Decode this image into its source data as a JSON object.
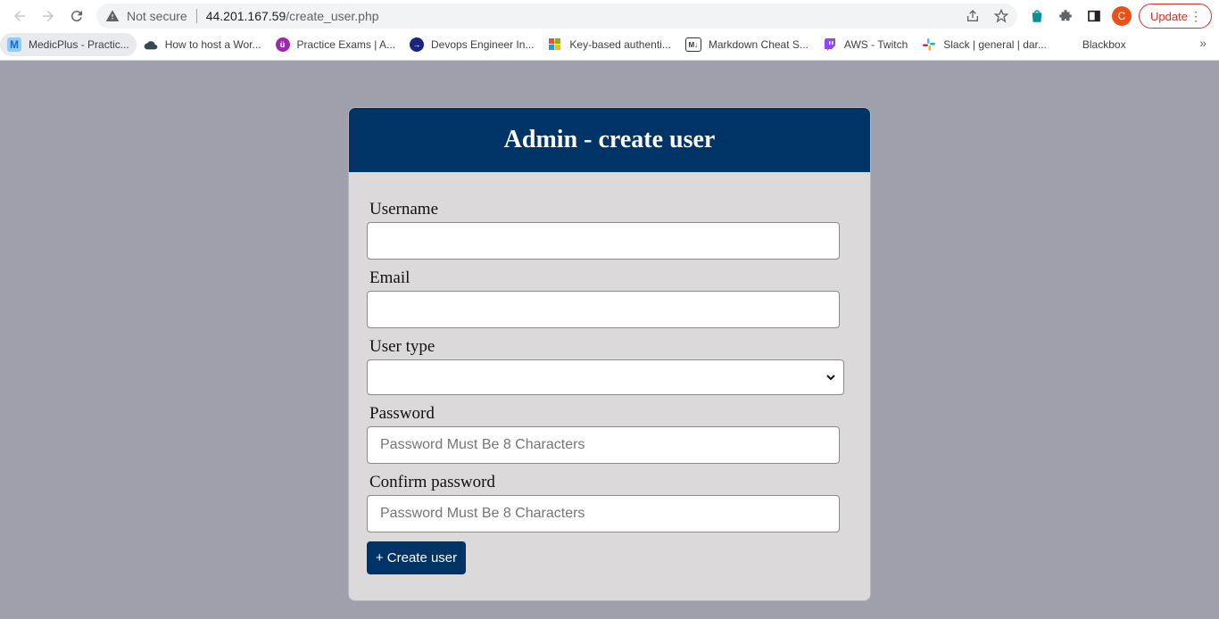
{
  "browser": {
    "security_label": "Not secure",
    "url_host": "44.201.167.59",
    "url_path": "/create_user.php",
    "avatar_letter": "C",
    "update_label": "Update"
  },
  "bookmarks": [
    {
      "label": "MedicPlus - Practic...",
      "icon": "M",
      "color": "#1565c0"
    },
    {
      "label": "How to host a Wor...",
      "icon": "cloud",
      "color": "#37474f"
    },
    {
      "label": "Practice Exams | A...",
      "icon": "ü",
      "color": "#9c27b0"
    },
    {
      "label": "Devops Engineer In...",
      "icon": "→",
      "color": "#1a237e"
    },
    {
      "label": "Key-based authenti...",
      "icon": "win",
      "color": "#f25022"
    },
    {
      "label": "Markdown Cheat S...",
      "icon": "M↓",
      "color": "#333333"
    },
    {
      "label": "AWS - Twitch",
      "icon": "tw",
      "color": "#9146ff"
    },
    {
      "label": "Slack | general | dar...",
      "icon": "#",
      "color": "#e01e5a"
    },
    {
      "label": "Blackbox",
      "icon": "",
      "color": "#ffffff"
    }
  ],
  "form": {
    "title": "Admin - create user",
    "username_label": "Username",
    "username_value": "",
    "email_label": "Email",
    "email_value": "",
    "usertype_label": "User type",
    "usertype_value": "",
    "password_label": "Password",
    "password_placeholder": "Password Must Be 8 Characters",
    "confirm_label": "Confirm password",
    "confirm_placeholder": "Password Must Be 8 Characters",
    "submit_label": "+ Create user"
  },
  "colors": {
    "header_bg": "#003366",
    "page_bg": "#a0a0ac",
    "card_bg": "#dbd9da"
  }
}
